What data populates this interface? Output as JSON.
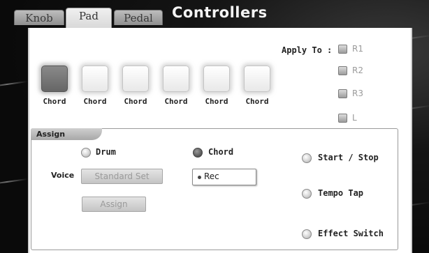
{
  "tabs": [
    {
      "label": "Knob",
      "active": false
    },
    {
      "label": "Pad",
      "active": true
    },
    {
      "label": "Pedal",
      "active": false
    }
  ],
  "title": "Controllers",
  "apply_to": {
    "label": "Apply To :",
    "items": [
      "R1",
      "R2",
      "R3",
      "L"
    ]
  },
  "pads": [
    {
      "label": "Chord",
      "selected": true
    },
    {
      "label": "Chord",
      "selected": false
    },
    {
      "label": "Chord",
      "selected": false
    },
    {
      "label": "Chord",
      "selected": false
    },
    {
      "label": "Chord",
      "selected": false
    },
    {
      "label": "Chord",
      "selected": false
    }
  ],
  "assign": {
    "section_label": "Assign",
    "drum_label": "Drum",
    "chord_label": "Chord",
    "voice_label": "Voice",
    "voice_value": "Standard Set",
    "rec_label": "Rec",
    "assign_button": "Assign",
    "selected_mode": "Chord"
  },
  "functions": [
    "Start / Stop",
    "Tempo Tap",
    "Effect Switch"
  ],
  "colors": {
    "panel_bg": "#ffffff",
    "title_color": "#f4f4f4",
    "disabled_text": "#9a9a9a"
  }
}
